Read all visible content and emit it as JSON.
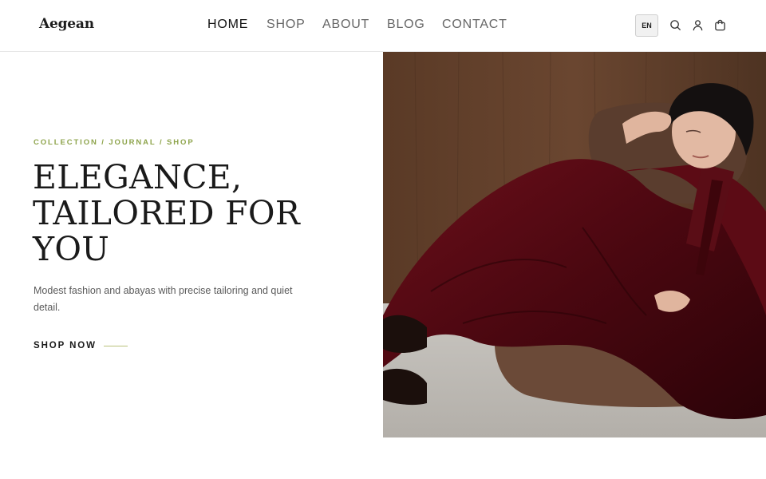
{
  "brand": {
    "name": "Aegean"
  },
  "nav": {
    "items": [
      {
        "label": "HOME",
        "active": true
      },
      {
        "label": "SHOP",
        "active": false
      },
      {
        "label": "ABOUT",
        "active": false
      },
      {
        "label": "BLOG",
        "active": false
      },
      {
        "label": "CONTACT",
        "active": false
      }
    ]
  },
  "header_actions": {
    "language": "EN",
    "icons": [
      "search-icon",
      "user-icon",
      "cart-icon"
    ]
  },
  "hero": {
    "eyebrow": "COLLECTION / JOURNAL / SHOP",
    "headline_lines": [
      "ELEGANCE,",
      "TAILORED FOR",
      "YOU"
    ],
    "subcopy": "Modest fashion and abayas with precise tailoring and quiet detail.",
    "cta_label": "SHOP NOW"
  },
  "colors": {
    "accent": "#8ea44c",
    "text": "#1a1a1a",
    "muted": "#5a5a5a",
    "border": "#e7e7e7"
  }
}
